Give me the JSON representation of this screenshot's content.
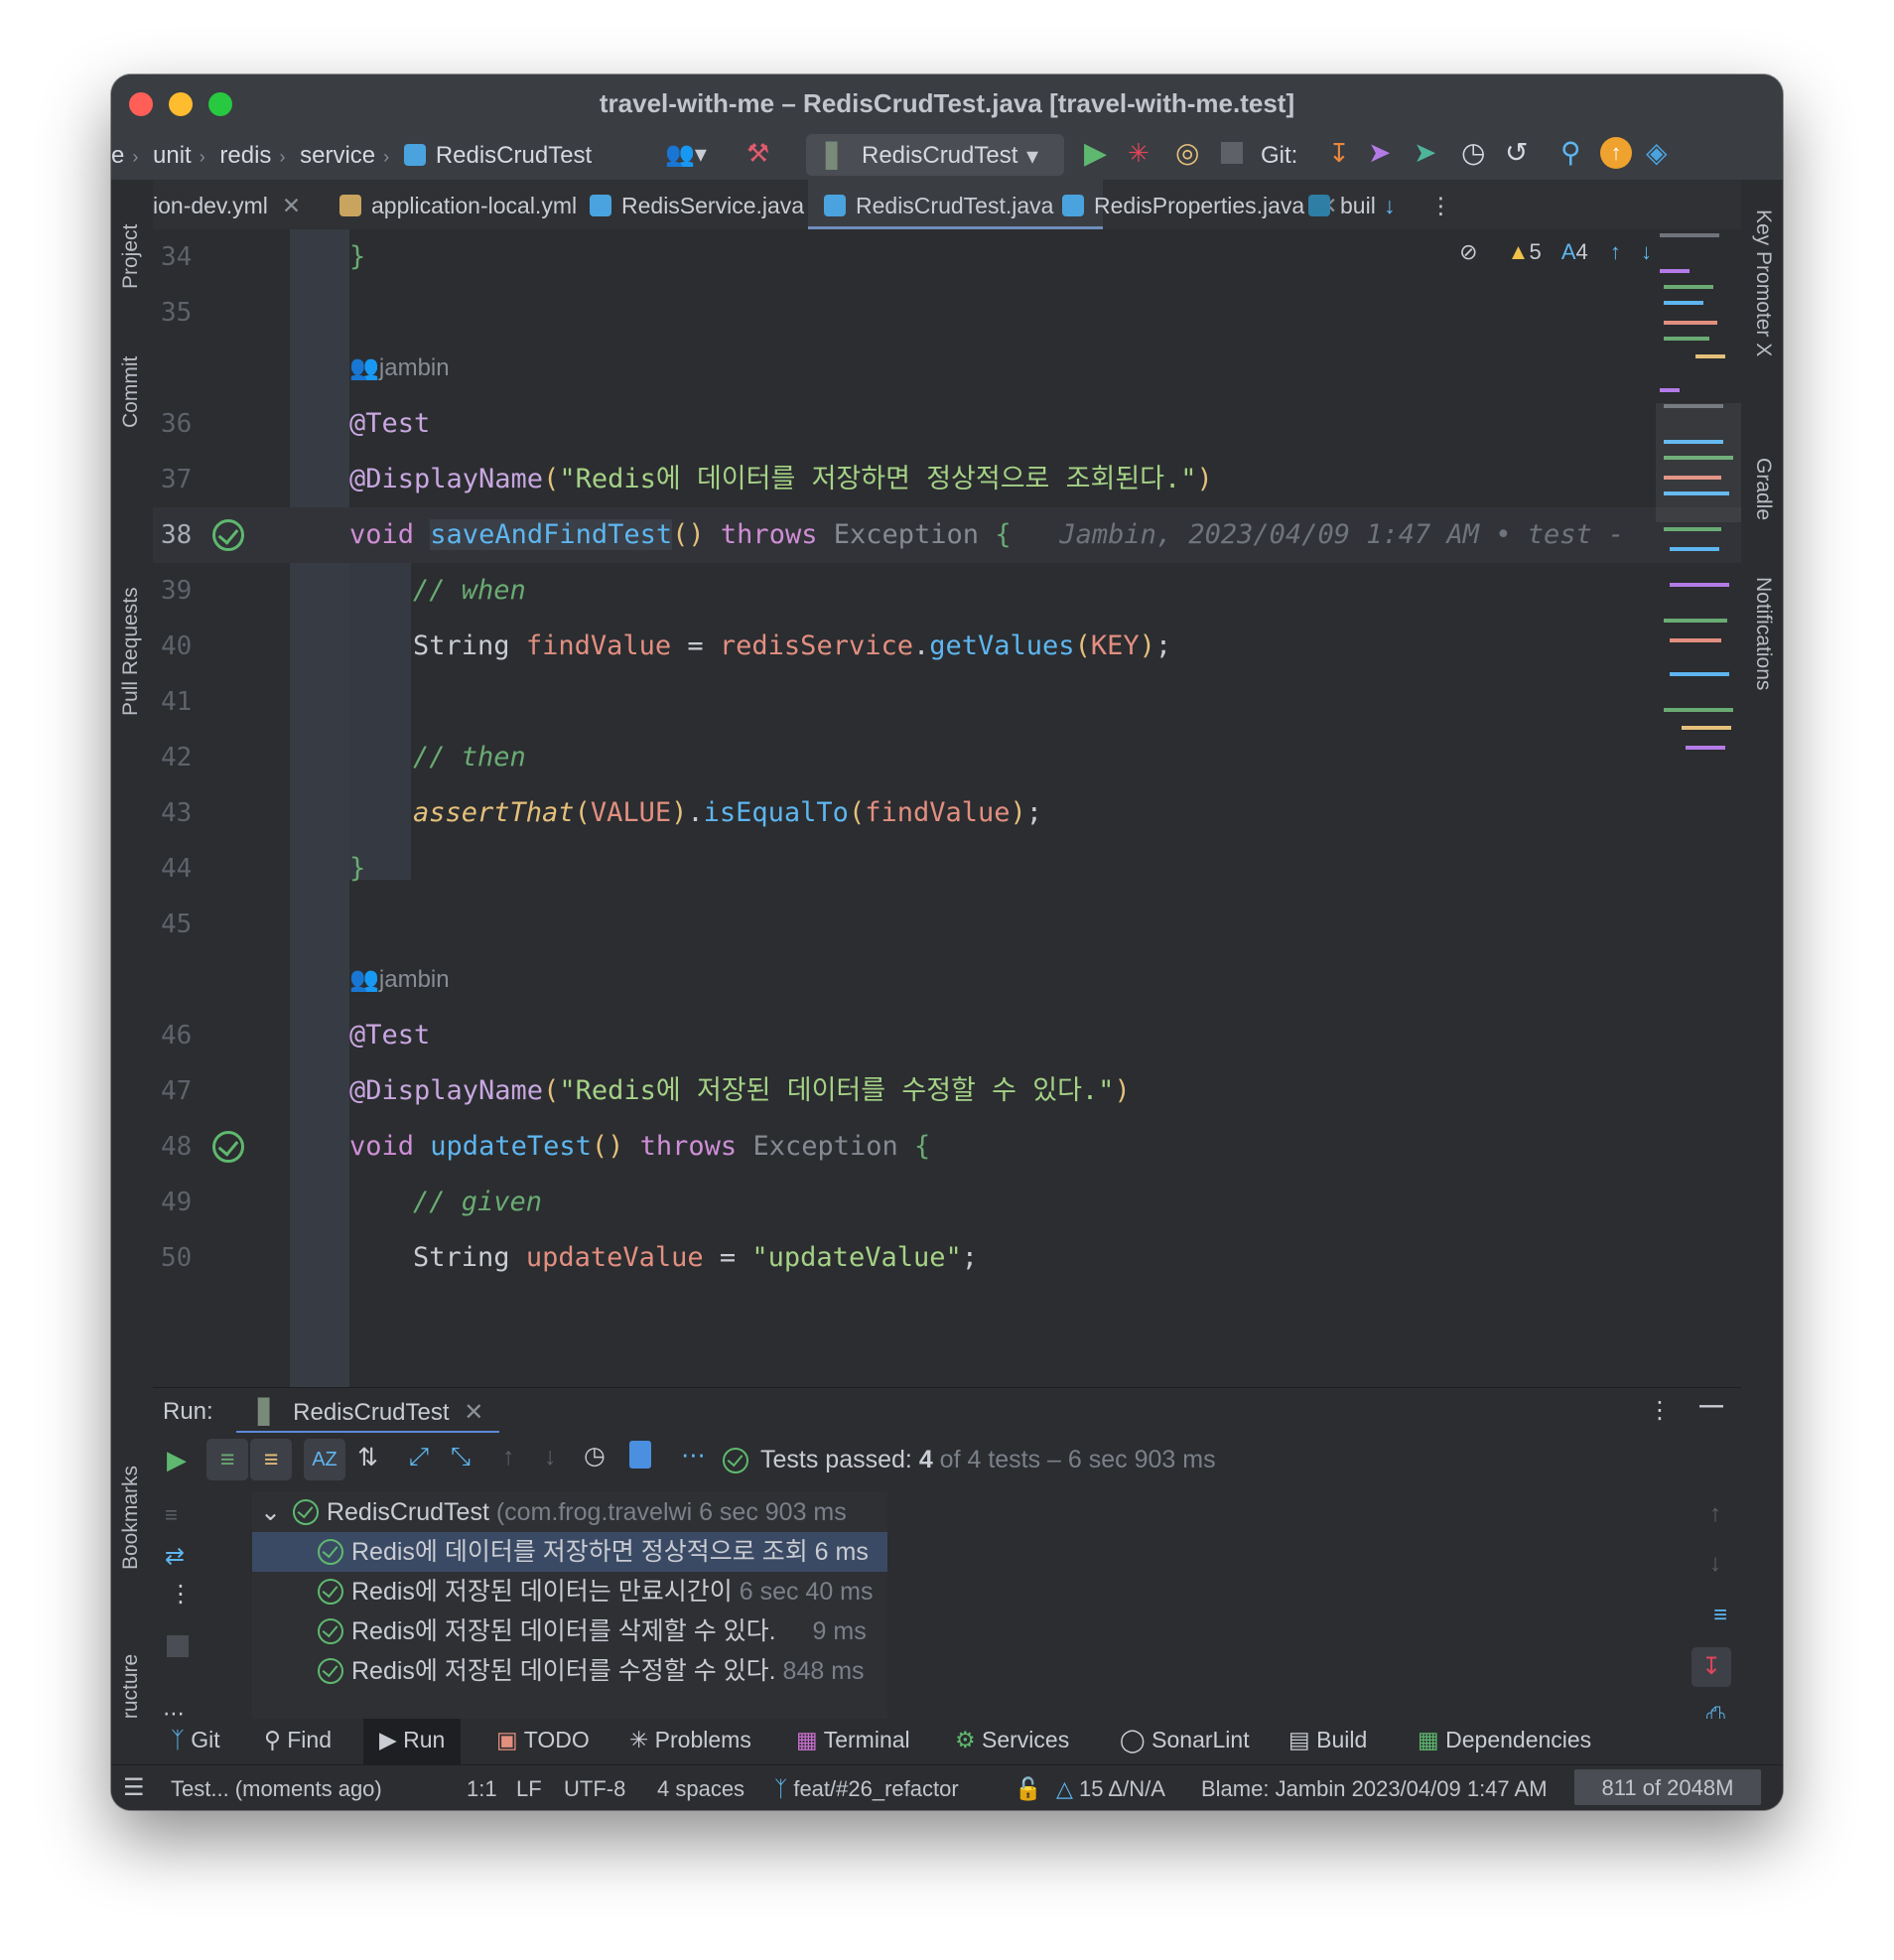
{
  "window": {
    "title": "travel-with-me – RedisCrudTest.java [travel-with-me.test]"
  },
  "toolbar": {
    "breadcrumb": [
      "e",
      "unit",
      "redis",
      "service",
      "RedisCrudTest"
    ],
    "run_config": "RedisCrudTest",
    "git_label": "Git:"
  },
  "tabs": [
    {
      "label": "ion-dev.yml"
    },
    {
      "label": "application-local.yml"
    },
    {
      "label": "RedisService.java"
    },
    {
      "label": "RedisCrudTest.java",
      "active": true
    },
    {
      "label": "RedisProperties.java"
    },
    {
      "label": "buil"
    }
  ],
  "left_tools": [
    "Project",
    "Commit",
    "Pull Requests",
    "Bookmarks",
    "Structure"
  ],
  "right_tools": [
    "Key Promoter X",
    "Gradle",
    "Notifications"
  ],
  "inspections": {
    "warnings": "5",
    "typos": "4"
  },
  "editor": {
    "author": "jambin",
    "blame_inline": "Jambin, 2023/04/09 1:47 AM • test -",
    "line_numbers": [
      "34",
      "35",
      "36",
      "37",
      "38",
      "39",
      "40",
      "41",
      "42",
      "43",
      "44",
      "45",
      "46",
      "47",
      "48",
      "49",
      "50"
    ]
  },
  "run": {
    "label": "Run:",
    "tab": "RedisCrudTest",
    "status_prefix": "Tests passed:",
    "status_count": "4",
    "status_suffix": "of 4 tests – 6 sec 903 ms",
    "tree": {
      "root": {
        "name": "RedisCrudTest",
        "pkg": "(com.frog.travelwi",
        "time": "6 sec 903 ms"
      },
      "children": [
        {
          "name": "Redis에 데이터를 저장하면 정상적으로 조회",
          "time": "6 ms",
          "selected": true
        },
        {
          "name": "Redis에 저장된 데이터는 만료시간이",
          "time": "6 sec 40 ms"
        },
        {
          "name": "Redis에 저장된 데이터를 삭제할 수 있다.",
          "time": "9 ms"
        },
        {
          "name": "Redis에 저장된 데이터를 수정할 수 있다.",
          "time": "848 ms"
        }
      ]
    }
  },
  "tool_windows": [
    "Git",
    "Find",
    "Run",
    "TODO",
    "Problems",
    "Terminal",
    "Services",
    "SonarLint",
    "Build",
    "Dependencies"
  ],
  "status": {
    "message": "Test... (moments ago)",
    "position": "1:1",
    "line_sep": "LF",
    "encoding": "UTF-8",
    "indent": "4 spaces",
    "branch": "feat/#26_refactor",
    "delta": "15 Δ/N/A",
    "blame": "Blame: Jambin 2023/04/09 1:47 AM",
    "memory": "811 of 2048M"
  },
  "colors": {
    "accent": "#6f8ebd",
    "pass": "#5fb86f",
    "keyword": "#cf8ed6",
    "function": "#5eb6f0",
    "string": "#a5d286"
  }
}
